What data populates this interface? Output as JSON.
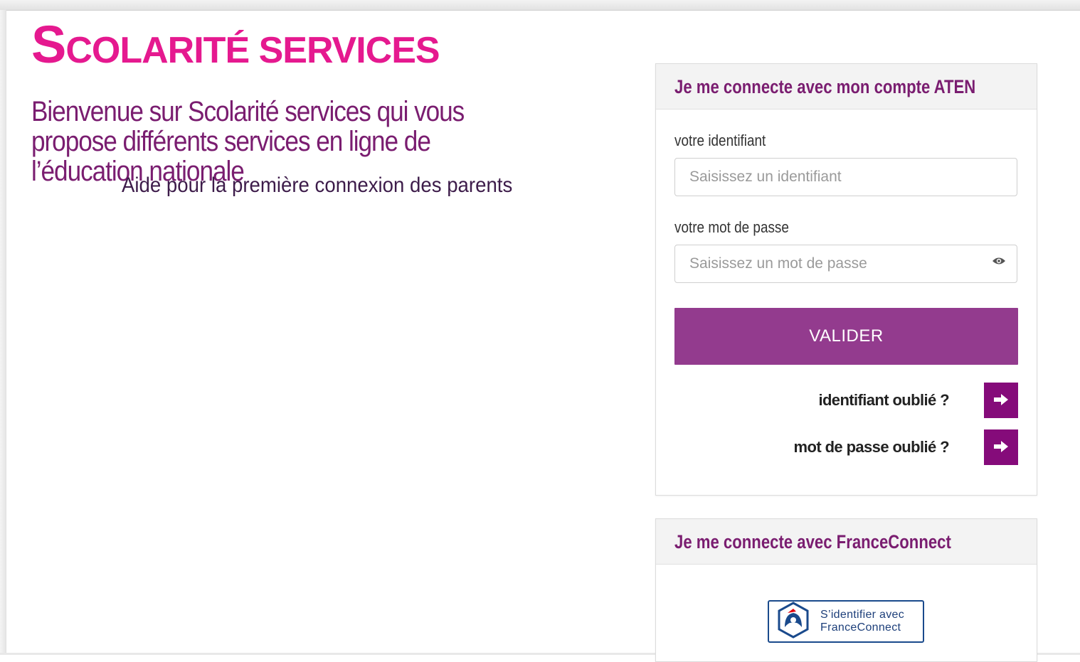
{
  "brand": {
    "logo_initial": "S",
    "logo_rest": "COLARITÉ SERVICES",
    "color": "#e5198f"
  },
  "intro": {
    "welcome": "Bienvenue sur Scolarité services qui vous propose différents services en ligne de l’éducation nationale",
    "help_link": "Aide pour la première connexion des parents"
  },
  "aten_login": {
    "title": "Je me connecte avec mon compte ATEN",
    "username_label": "votre identifiant",
    "username_placeholder": "Saisissez un identifiant",
    "password_label": "votre mot de passe",
    "password_placeholder": "Saisissez un mot de passe",
    "password_toggle_icon": "eye-icon",
    "submit_label": "VALIDER",
    "forgot_username": "identifiant oublié ?",
    "forgot_password": "mot de passe oublié ?",
    "forgot_arrow_icon": "arrow-right-icon"
  },
  "franceconnect": {
    "title": "Je me connecte avec FranceConnect",
    "button_line1": "S’identifier avec",
    "button_line2": "FranceConnect"
  },
  "colors": {
    "title": "#7a1d70",
    "submit_button": "#933b8e",
    "arrow_button": "#850b7a",
    "franceconnect_blue": "#1a4a8c"
  }
}
